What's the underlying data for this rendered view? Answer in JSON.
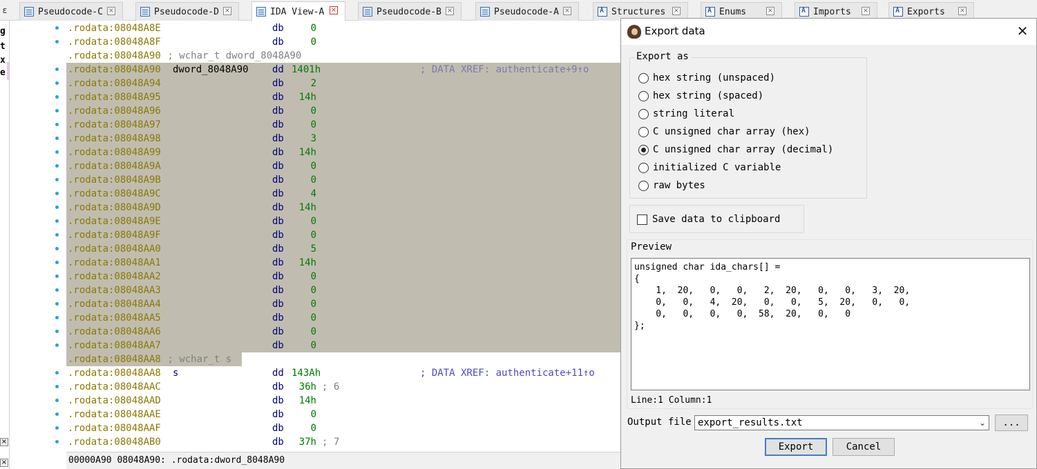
{
  "tabs": [
    {
      "label": "Pseudocode-C",
      "active": false
    },
    {
      "label": "Pseudocode-D",
      "active": false
    },
    {
      "label": "IDA View-A",
      "active": true
    },
    {
      "label": "Pseudocode-B",
      "active": false
    },
    {
      "label": "Pseudocode-A",
      "active": false
    },
    {
      "label": "Structures",
      "active": false
    },
    {
      "label": "Enums",
      "active": false
    },
    {
      "label": "Imports",
      "active": false
    },
    {
      "label": "Exports",
      "active": false
    }
  ],
  "tab_close_glyph": "×",
  "left_edge_chars": [
    "g",
    "t",
    "x",
    "e:"
  ],
  "listing": {
    "pre_lines": [
      {
        "addr": ".rodata:08048A8E",
        "op": "db",
        "val": "0"
      },
      {
        "addr": ".rodata:08048A8F",
        "op": "db",
        "val": "0"
      }
    ],
    "wchar1": {
      "addr": ".rodata:08048A90",
      "text": " ; wchar_t dword_8048A90"
    },
    "dword_line": {
      "addr": ".rodata:08048A90",
      "name": "dword_8048A90",
      "op": "dd",
      "val": "1401h",
      "xref": "; DATA XREF: authenticate+9↑o"
    },
    "sel_lines": [
      {
        "addr": ".rodata:08048A94",
        "op": "db",
        "val": "2"
      },
      {
        "addr": ".rodata:08048A95",
        "op": "db",
        "val": "14h"
      },
      {
        "addr": ".rodata:08048A96",
        "op": "db",
        "val": "0"
      },
      {
        "addr": ".rodata:08048A97",
        "op": "db",
        "val": "0"
      },
      {
        "addr": ".rodata:08048A98",
        "op": "db",
        "val": "3"
      },
      {
        "addr": ".rodata:08048A99",
        "op": "db",
        "val": "14h"
      },
      {
        "addr": ".rodata:08048A9A",
        "op": "db",
        "val": "0"
      },
      {
        "addr": ".rodata:08048A9B",
        "op": "db",
        "val": "0"
      },
      {
        "addr": ".rodata:08048A9C",
        "op": "db",
        "val": "4"
      },
      {
        "addr": ".rodata:08048A9D",
        "op": "db",
        "val": "14h"
      },
      {
        "addr": ".rodata:08048A9E",
        "op": "db",
        "val": "0"
      },
      {
        "addr": ".rodata:08048A9F",
        "op": "db",
        "val": "0"
      },
      {
        "addr": ".rodata:08048AA0",
        "op": "db",
        "val": "5"
      },
      {
        "addr": ".rodata:08048AA1",
        "op": "db",
        "val": "14h"
      },
      {
        "addr": ".rodata:08048AA2",
        "op": "db",
        "val": "0"
      },
      {
        "addr": ".rodata:08048AA3",
        "op": "db",
        "val": "0"
      },
      {
        "addr": ".rodata:08048AA4",
        "op": "db",
        "val": "0"
      },
      {
        "addr": ".rodata:08048AA5",
        "op": "db",
        "val": "0"
      },
      {
        "addr": ".rodata:08048AA6",
        "op": "db",
        "val": "0"
      },
      {
        "addr": ".rodata:08048AA7",
        "op": "db",
        "val": "0"
      }
    ],
    "wchar2": {
      "addr": ".rodata:08048AA8",
      "text": " ; wchar_t s"
    },
    "s_line": {
      "addr": ".rodata:08048AA8",
      "name": "s",
      "op": "dd",
      "val": "143Ah",
      "xref": "; DATA XREF: authenticate+11↑o"
    },
    "post_lines": [
      {
        "addr": ".rodata:08048AAC",
        "op": "db",
        "val": "36h",
        "cmt": "; 6"
      },
      {
        "addr": ".rodata:08048AAD",
        "op": "db",
        "val": "14h",
        "cmt": ""
      },
      {
        "addr": ".rodata:08048AAE",
        "op": "db",
        "val": "0",
        "cmt": ""
      },
      {
        "addr": ".rodata:08048AAF",
        "op": "db",
        "val": "0",
        "cmt": ""
      },
      {
        "addr": ".rodata:08048AB0",
        "op": "db",
        "val": "37h",
        "cmt": "; 7"
      }
    ]
  },
  "statusbar": "00000A90 08048A90: .rodata:dword_8048A90",
  "dialog": {
    "title": "Export data",
    "close_glyph": "✕",
    "export_as_label": "Export as",
    "options": [
      {
        "label": "hex string (unspaced)",
        "selected": false
      },
      {
        "label": "hex string (spaced)",
        "selected": false
      },
      {
        "label": "string literal",
        "selected": false
      },
      {
        "label": "C unsigned char array (hex)",
        "selected": false
      },
      {
        "label": "C unsigned char array (decimal)",
        "selected": true
      },
      {
        "label": "initialized C variable",
        "selected": false
      },
      {
        "label": "raw bytes",
        "selected": false
      }
    ],
    "clipboard_label": "Save data to clipboard",
    "clipboard_checked": false,
    "preview_label": "Preview",
    "preview_lines": [
      "unsigned char ida_chars[] =",
      "{",
      "    1,  20,   0,   0,   2,  20,   0,   0,   3,  20,",
      "    0,   0,   4,  20,   0,   0,   5,  20,   0,   0,",
      "    0,   0,   0,   0,  58,  20,   0,   0",
      "};"
    ],
    "cursor_status": "Line:1  Column:1",
    "output_file_label": "Output file",
    "output_file_value": "export_results.txt",
    "browse_label": "...",
    "export_button": "Export",
    "cancel_button": "Cancel"
  }
}
